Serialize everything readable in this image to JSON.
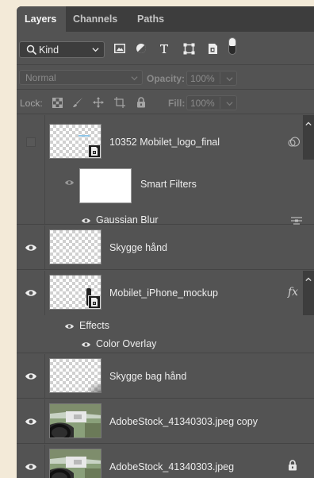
{
  "tabs": [
    {
      "label": "Layers",
      "active": true
    },
    {
      "label": "Channels",
      "active": false
    },
    {
      "label": "Paths",
      "active": false
    }
  ],
  "filter": {
    "kind_label": "Kind",
    "icons": [
      "pixel-filter-icon",
      "adjustment-filter-icon",
      "type-filter-icon",
      "shape-filter-icon",
      "smart-object-filter-icon"
    ]
  },
  "blend": {
    "mode": "Normal",
    "opacity_label": "Opacity:",
    "opacity_value": "100%"
  },
  "lock": {
    "label": "Lock:",
    "fill_label": "Fill:",
    "fill_value": "100%"
  },
  "layers": [
    {
      "name": "10352 Mobilet_logo_final",
      "visible": false,
      "smart_object": true,
      "sub": {
        "mask_label": "Smart Filters",
        "filter_name": "Gaussian Blur"
      }
    },
    {
      "name": "Skygge hånd",
      "visible": true
    },
    {
      "name": "Mobilet_iPhone_mockup",
      "visible": true,
      "smart_object": true,
      "fx": "fx",
      "effects": {
        "label": "Effects",
        "items": [
          "Color Overlay"
        ]
      }
    },
    {
      "name": "Skygge bag hånd",
      "visible": true
    },
    {
      "name": "AdobeStock_41340303.jpeg copy",
      "visible": true
    },
    {
      "name": "AdobeStock_41340303.jpeg",
      "visible": true,
      "locked": true
    }
  ],
  "colors": {
    "panel_bg": "#535353",
    "tab_bar": "#3d3d3d",
    "page_bg": "#f3ead8"
  }
}
